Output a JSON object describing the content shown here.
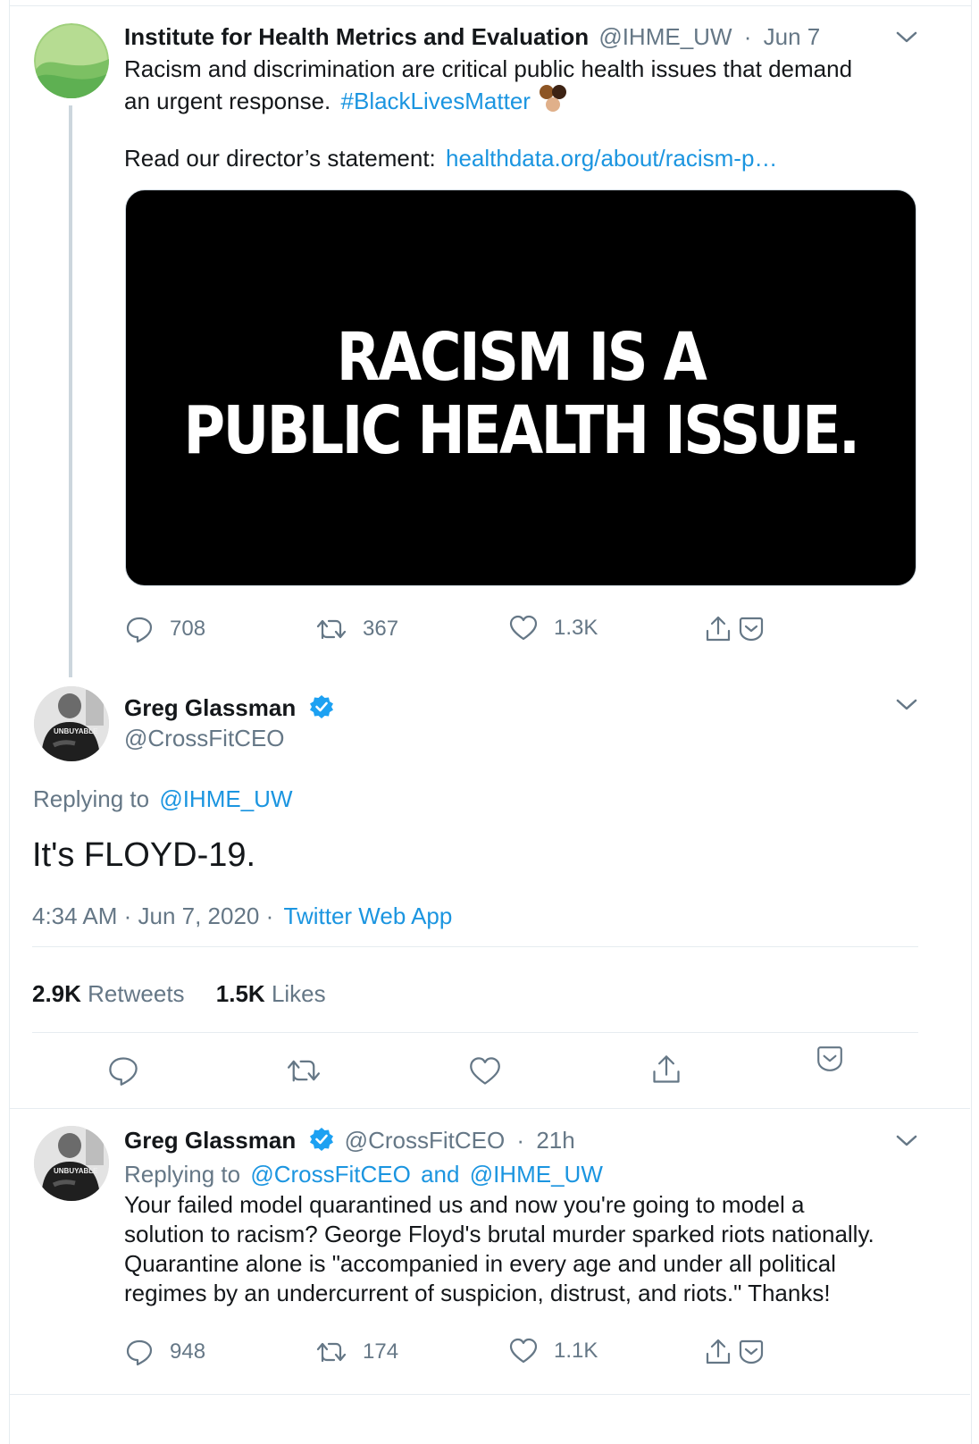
{
  "tweet1": {
    "name": "Institute for Health Metrics and Evaluation",
    "handle": "@IHME_UW",
    "sep": "·",
    "date": "Jun 7",
    "text_line1": "Racism and discrimination are critical public health issues that demand",
    "text_line2": "an urgent response.",
    "hashtag": "#BlackLivesMatter",
    "read_label": "Read our director’s statement:",
    "link": "healthdata.org/about/racism-p…",
    "image_line1": "RACISM IS A",
    "image_line2": "PUBLIC HEALTH ISSUE.",
    "replies": "708",
    "retweets": "367",
    "likes": "1.3K"
  },
  "tweet2": {
    "name": "Greg Glassman",
    "handle": "@CrossFitCEO",
    "replying_label": "Replying to",
    "replying_to": "@IHME_UW",
    "text": "It's FLOYD-19.",
    "time": "4:34 AM · Jun 7, 2020 ·",
    "source": "Twitter Web App",
    "retweet_count": "2.9K",
    "retweet_label": "Retweets",
    "like_count": "1.5K",
    "like_label": "Likes"
  },
  "tweet3": {
    "name": "Greg Glassman",
    "handle": "@CrossFitCEO",
    "sep": "·",
    "time": "21h",
    "replying_label": "Replying to",
    "replying_to1": "@CrossFitCEO",
    "replying_and": "and",
    "replying_to2": "@IHME_UW",
    "text_line1": "Your failed model quarantined us and now you're going to model a",
    "text_line2": "solution to racism? George Floyd's brutal murder sparked riots nationally.",
    "text_line3": "Quarantine alone is \"accompanied in every age and under all political",
    "text_line4": "regimes by an undercurrent of suspicion, distrust, and riots.\" Thanks!",
    "replies": "948",
    "retweets": "174",
    "likes": "1.1K"
  },
  "avatar_shirt_text": "UNBUYABLE",
  "colors": {
    "link": "#1b95e0",
    "muted": "#657786",
    "text": "#14171a",
    "border": "#e6ecf0",
    "verified": "#1da1f2",
    "ihme_green": "#5eb052"
  },
  "icons": [
    "chevron-down-icon",
    "reply-icon",
    "retweet-icon",
    "like-icon",
    "share-icon",
    "save-tweet-icon",
    "verified-badge-icon",
    "fist-emoji-icon"
  ]
}
